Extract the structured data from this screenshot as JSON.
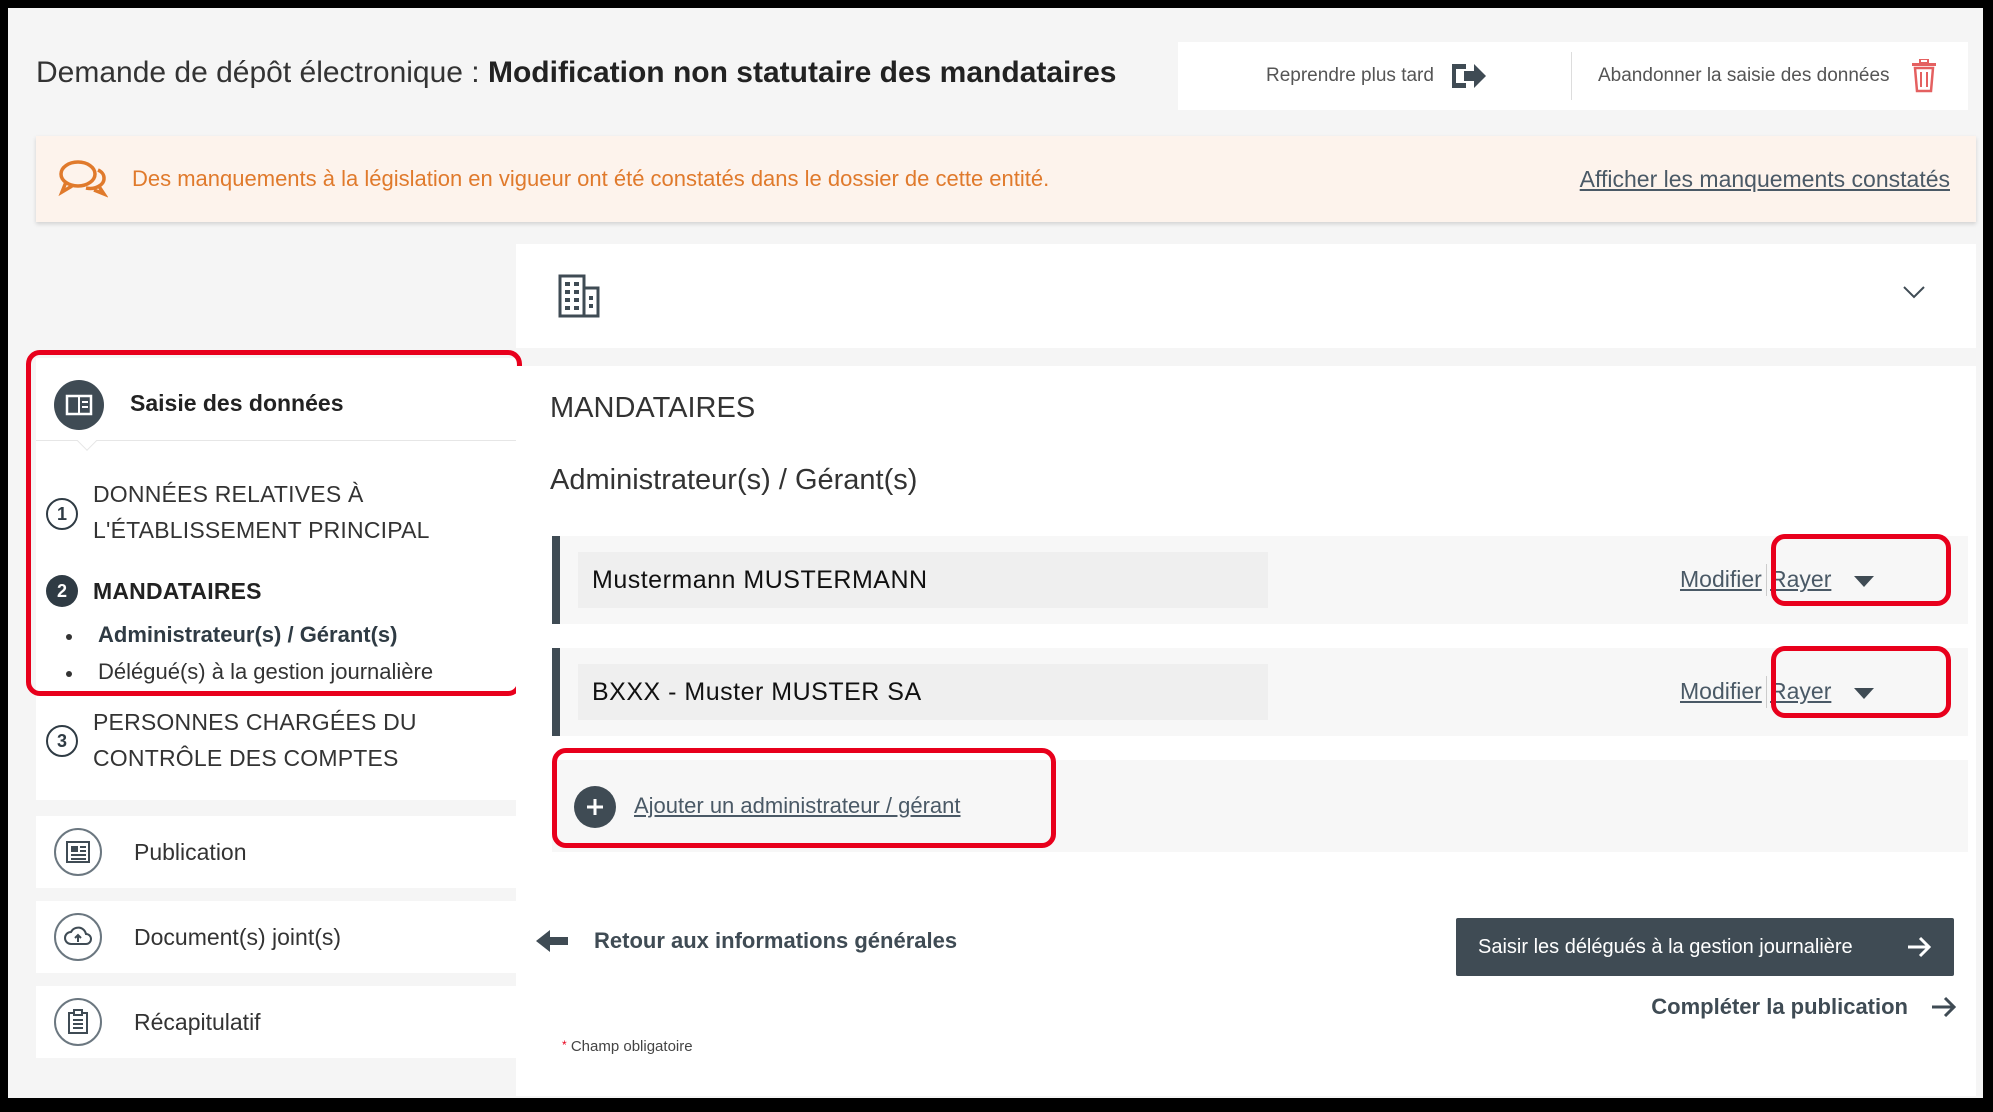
{
  "header": {
    "title_prefix": "Demande de dépôt électronique : ",
    "title_bold": "Modification non statutaire des mandataires",
    "resume_later": "Reprendre plus tard",
    "abandon": "Abandonner la saisie des données"
  },
  "alert": {
    "message": "Des manquements à la législation en vigueur ont été constatés dans le dossier de cette entité.",
    "link": "Afficher les manquements constatés",
    "color": "#e07a2c"
  },
  "sidebar": {
    "data_entry_title": "Saisie des données",
    "steps": [
      {
        "num": "1",
        "label_line1": "DONNÉES RELATIVES À",
        "label_line2": "L'ÉTABLISSEMENT PRINCIPAL"
      },
      {
        "num": "2",
        "label_line1": "MANDATAIRES"
      },
      {
        "num": "3",
        "label_line1": "PERSONNES CHARGÉES DU",
        "label_line2": "CONTRÔLE DES COMPTES"
      }
    ],
    "substeps": [
      "Administrateur(s) / Gérant(s)",
      "Délégué(s) à la gestion journalière"
    ],
    "items": [
      "Publication",
      "Document(s) joint(s)",
      "Récapitulatif"
    ]
  },
  "main": {
    "section_title": "MANDATAIRES",
    "subsection_title": "Administrateur(s) / Gérant(s)",
    "mandataires": [
      {
        "name": "Mustermann  MUSTERMANN",
        "modify": "Modifier",
        "strike": "Rayer"
      },
      {
        "name": "BXXX - Muster MUSTER SA",
        "modify": "Modifier",
        "strike": "Rayer"
      }
    ],
    "add_label": "Ajouter un administrateur / gérant",
    "back_label": "Retour aux informations générales",
    "next_button": "Saisir les délégués à la gestion journalière",
    "complete_label": "Compléter la publication",
    "required_note": "Champ obligatoire"
  },
  "colors": {
    "dark": "#3f4b54",
    "highlight": "#e8001c"
  }
}
